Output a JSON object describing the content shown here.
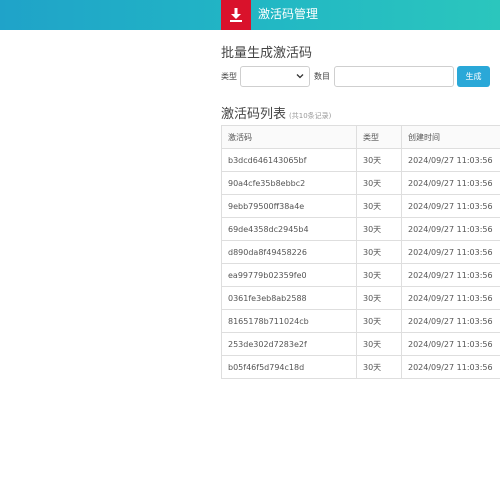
{
  "header": {
    "app_title": "激活码管理",
    "logo_icon": "download-icon"
  },
  "generate": {
    "title": "批量生成激活码",
    "type_label": "类型",
    "type_value": "",
    "count_label": "数目",
    "count_value": "",
    "button_label": "生成"
  },
  "list": {
    "title": "激活码列表",
    "record_count": "(共10条记录)",
    "columns": [
      "激活码",
      "类型",
      "创建时间"
    ],
    "rows": [
      {
        "code": "b3dcd646143065bf",
        "type": "30天",
        "created": "2024/09/27 11:03:56"
      },
      {
        "code": "90a4cfe35b8ebbc2",
        "type": "30天",
        "created": "2024/09/27 11:03:56"
      },
      {
        "code": "9ebb79500ff38a4e",
        "type": "30天",
        "created": "2024/09/27 11:03:56"
      },
      {
        "code": "69de4358dc2945b4",
        "type": "30天",
        "created": "2024/09/27 11:03:56"
      },
      {
        "code": "d890da8f49458226",
        "type": "30天",
        "created": "2024/09/27 11:03:56"
      },
      {
        "code": "ea99779b02359fe0",
        "type": "30天",
        "created": "2024/09/27 11:03:56"
      },
      {
        "code": "0361fe3eb8ab2588",
        "type": "30天",
        "created": "2024/09/27 11:03:56"
      },
      {
        "code": "8165178b711024cb",
        "type": "30天",
        "created": "2024/09/27 11:03:56"
      },
      {
        "code": "253de302d7283e2f",
        "type": "30天",
        "created": "2024/09/27 11:03:56"
      },
      {
        "code": "b05f46f5d794c18d",
        "type": "30天",
        "created": "2024/09/27 11:03:56"
      }
    ]
  },
  "colors": {
    "header_gradient_start": "#1fa3c9",
    "header_gradient_end": "#2bc6bd",
    "logo_red": "#d9122b",
    "button_blue": "#2aa8d8"
  }
}
